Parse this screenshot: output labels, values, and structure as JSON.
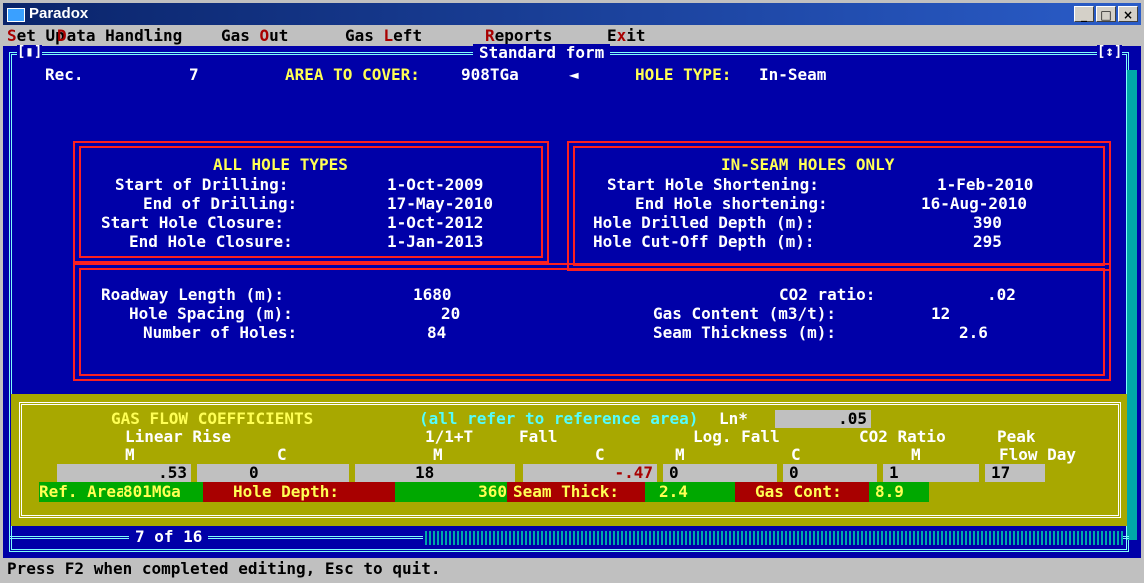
{
  "window": {
    "title": "Paradox",
    "buttons": {
      "minimize": "_",
      "maximize": "□",
      "close": "×"
    }
  },
  "menu": [
    {
      "pre": "",
      "hot": "S",
      "post": "et Up"
    },
    {
      "pre": "",
      "hot": "D",
      "post": "ata Handling"
    },
    {
      "pre": "Gas ",
      "hot": "O",
      "post": "ut"
    },
    {
      "pre": "Gas ",
      "hot": "L",
      "post": "eft"
    },
    {
      "pre": "",
      "hot": "R",
      "post": "eports"
    },
    {
      "pre": "E",
      "hot": "x",
      "post": "it"
    }
  ],
  "form": {
    "title": "Standard form",
    "tag_left": "[▮]",
    "tag_right": "[↕]",
    "rec_label": "Rec.",
    "rec_value": "7",
    "area_label": "AREA TO COVER:",
    "area_value": "908TGa",
    "area_arrow": "◄",
    "hole_type_label": "HOLE TYPE:",
    "hole_type_value": "In-Seam"
  },
  "all_hole_types": {
    "heading": "ALL HOLE TYPES",
    "rows": [
      {
        "label": "Start of Drilling:",
        "value": "1-Oct-2009"
      },
      {
        "label": "End of Drilling:",
        "value": "17-May-2010"
      },
      {
        "label": "Start Hole Closure:",
        "value": "1-Oct-2012"
      },
      {
        "label": "End Hole Closure:",
        "value": "1-Jan-2013"
      }
    ]
  },
  "in_seam": {
    "heading": "IN-SEAM HOLES ONLY",
    "rows": [
      {
        "label": "Start Hole Shortening:",
        "value": "1-Feb-2010"
      },
      {
        "label": "End Hole shortening:",
        "value": "16-Aug-2010"
      },
      {
        "label": "Hole Drilled Depth (m):",
        "value": "390"
      },
      {
        "label": "Hole Cut-Off Depth (m):",
        "value": "295"
      }
    ]
  },
  "roadway": [
    {
      "label": "Roadway Length (m):",
      "value": "1680"
    },
    {
      "label": "Hole Spacing (m):",
      "value": "20"
    },
    {
      "label": "Number of Holes:",
      "value": "84"
    }
  ],
  "gas": [
    {
      "label": "CO2 ratio:",
      "value": ".02"
    },
    {
      "label": "Gas Content (m3/t):",
      "value": "12"
    },
    {
      "label": "Seam Thickness (m):",
      "value": "2.6"
    }
  ],
  "coeff": {
    "heading": "GAS FLOW COEFFICIENTS",
    "note": "(all refer to reference area)",
    "ln_label": "Ln*",
    "ln_value": ".05",
    "header1": {
      "linear_rise": "Linear Rise",
      "one_t": "1/1+T",
      "fall": "Fall",
      "log_fall": "Log. Fall",
      "co2": "CO2 Ratio",
      "peak": "Peak"
    },
    "header2": {
      "m1": "M",
      "c1": "C",
      "m2": "M",
      "c2": "C",
      "m3": "M",
      "c3": "C",
      "m4": "M",
      "flowday": "Flow Day"
    },
    "values": [
      ".53",
      "0",
      "18",
      "-.47",
      "0",
      "0",
      "1",
      "17"
    ],
    "ref": [
      {
        "text": "Ref. Area:",
        "kind": "label"
      },
      {
        "text": "801MGa",
        "kind": "value"
      },
      {
        "text": "Hole Depth:",
        "kind": "label"
      },
      {
        "text": "360",
        "kind": "value"
      },
      {
        "text": "Seam Thick:",
        "kind": "label"
      },
      {
        "text": "2.4",
        "kind": "value"
      },
      {
        "text": "Gas Cont:",
        "kind": "label"
      },
      {
        "text": "8.9",
        "kind": "value"
      }
    ]
  },
  "record_count": "7 of 16",
  "status": "Press F2 when completed editing, Esc to quit.",
  "colors": {
    "screen": "#0000a8",
    "panel": "#a8a800",
    "red_cell": "#a80000",
    "green_cell": "#00a800",
    "border_red": "#fc2020",
    "yellow_text": "#ffff54"
  }
}
